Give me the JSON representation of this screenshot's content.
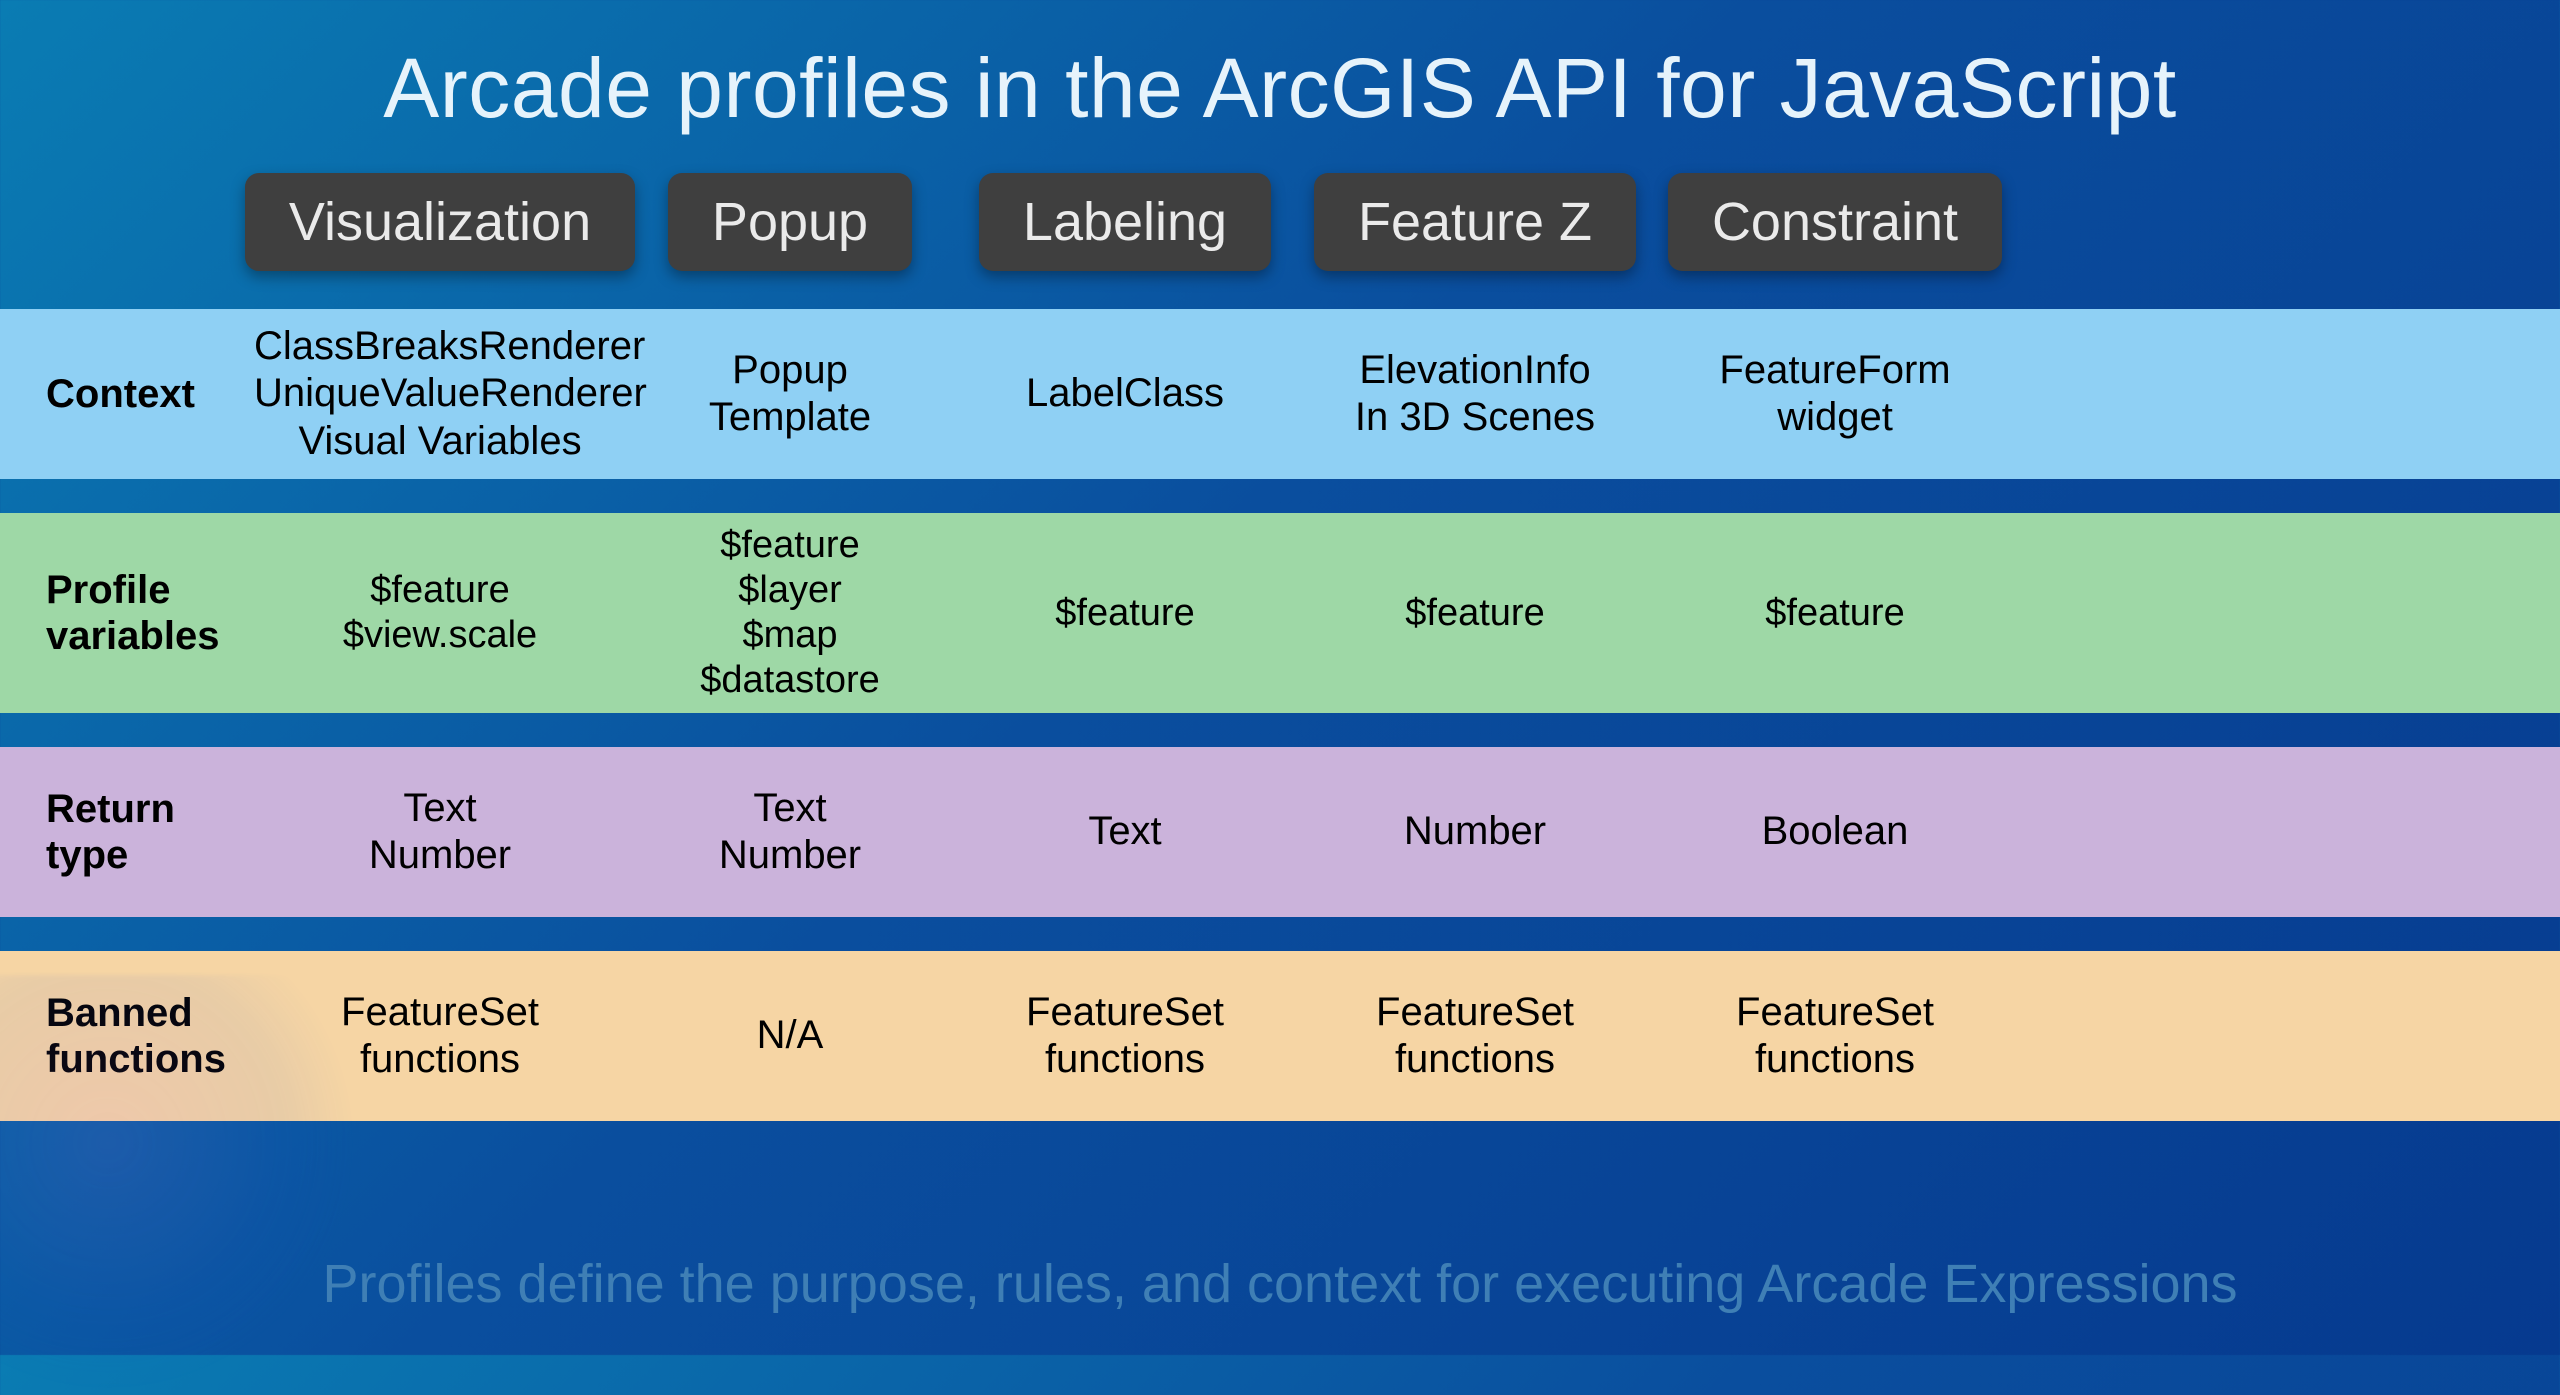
{
  "title": "Arcade profiles in the ArcGIS API for JavaScript",
  "footer": "Profiles define the purpose, rules, and context for executing Arcade Expressions",
  "columns": [
    {
      "label": "Visualization"
    },
    {
      "label": "Popup"
    },
    {
      "label": "Labeling"
    },
    {
      "label": "Feature Z"
    },
    {
      "label": "Constraint"
    }
  ],
  "rows": {
    "context": {
      "label": "Context",
      "cells": [
        "ClassBreaksRenderer\nUniqueValueRenderer\nVisual Variables",
        "Popup\nTemplate",
        "LabelClass",
        "ElevationInfo\nIn 3D Scenes",
        "FeatureForm\nwidget"
      ]
    },
    "profile_variables": {
      "label": "Profile\nvariables",
      "cells": [
        "$feature\n$view.scale",
        "$feature\n$layer\n$map\n$datastore",
        "$feature",
        "$feature",
        "$feature"
      ]
    },
    "return_type": {
      "label": "Return\ntype",
      "cells": [
        "Text\nNumber",
        "Text\nNumber",
        "Text",
        "Number",
        "Boolean"
      ]
    },
    "banned_functions": {
      "label": "Banned\nfunctions",
      "cells": [
        "FeatureSet\nfunctions",
        "N/A",
        "FeatureSet\nfunctions",
        "FeatureSet\nfunctions",
        "FeatureSet\nfunctions"
      ]
    }
  }
}
